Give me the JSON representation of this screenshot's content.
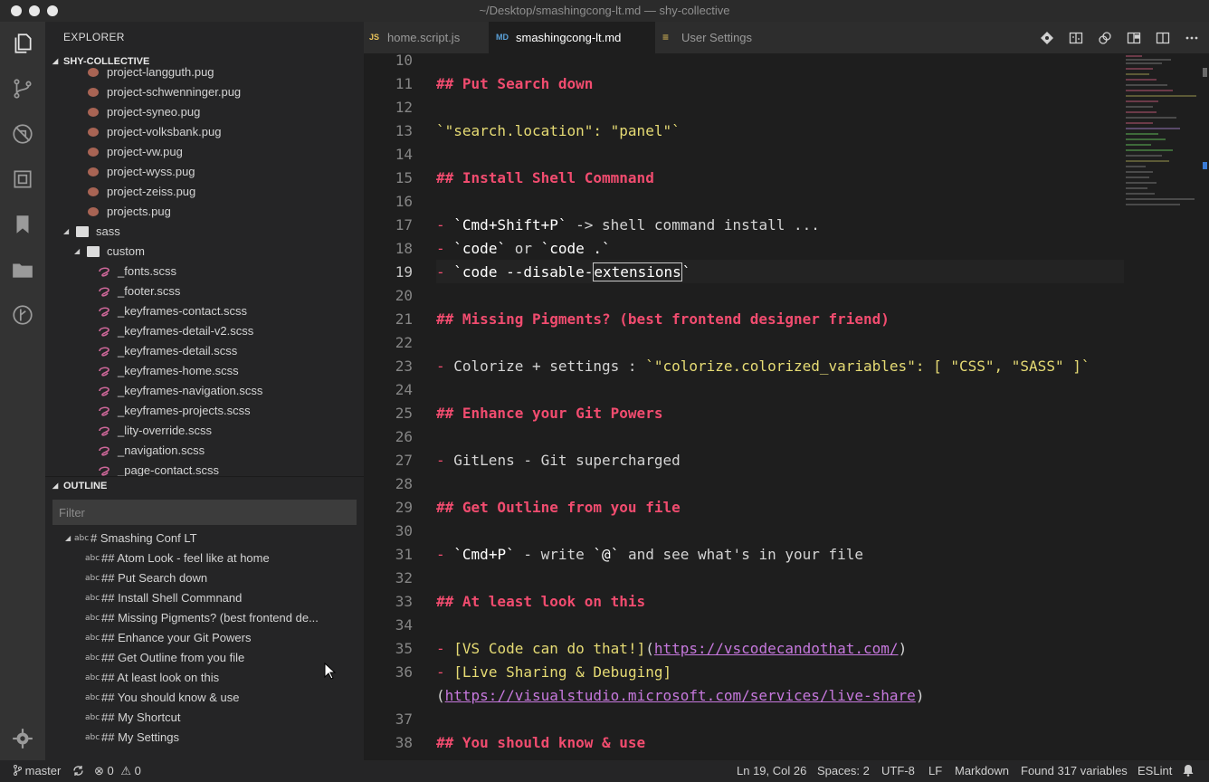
{
  "window": {
    "title": "~/Desktop/smashingcong-lt.md — shy-collective"
  },
  "sidebar": {
    "title": "EXPLORER",
    "project": "SHY-COLLECTIVE",
    "files": [
      "project-langguth.pug",
      "project-schwenninger.pug",
      "project-syneo.pug",
      "project-volksbank.pug",
      "project-vw.pug",
      "project-wyss.pug",
      "project-zeiss.pug",
      "projects.pug"
    ],
    "folders": {
      "sass": "sass",
      "custom": "custom"
    },
    "scss_files": [
      "_fonts.scss",
      "_footer.scss",
      "_keyframes-contact.scss",
      "_keyframes-detail-v2.scss",
      "_keyframes-detail.scss",
      "_keyframes-home.scss",
      "_keyframes-navigation.scss",
      "_keyframes-projects.scss",
      "_lity-override.scss",
      "_navigation.scss",
      "_page-contact.scss"
    ]
  },
  "outline": {
    "title": "OUTLINE",
    "filter_placeholder": "Filter",
    "symbol_kind": "abc",
    "root": "# Smashing Conf LT",
    "items": [
      "## Atom Look - feel like at home",
      "## Put Search down",
      "## Install Shell Commnand",
      "## Missing Pigments? (best frontend de...",
      "## Enhance your Git Powers",
      "## Get Outline from you file",
      "## At least look on this",
      "## You should know & use",
      "## My Shortcut",
      "## My Settings"
    ]
  },
  "tabs": [
    {
      "icon": "JS",
      "label": "home.script.js"
    },
    {
      "icon": "MD",
      "label": "smashingcong-lt.md"
    },
    {
      "icon": "≡",
      "label": "User Settings"
    }
  ],
  "editor": {
    "line_numbers": [
      "10",
      "11",
      "12",
      "13",
      "14",
      "15",
      "16",
      "17",
      "18",
      "19",
      "20",
      "21",
      "22",
      "23",
      "24",
      "25",
      "26",
      "27",
      "28",
      "29",
      "30",
      "31",
      "32",
      "33",
      "34",
      "35",
      "36",
      "37",
      "38"
    ],
    "current_line": "19",
    "lines": {
      "l11": "## Put Search down",
      "l13": "`\"search.location\": \"panel\"`",
      "l15": "## Install Shell Commnand",
      "l17_dash": "-",
      "l17_code": "`Cmd+Shift+P`",
      "l17_rest": " -> shell command install ...",
      "l18_dash": "-",
      "l18_code1": "`code`",
      "l18_mid": " or ",
      "l18_code2": "`code .`",
      "l19_dash": "-",
      "l19_a": "`code --disable-",
      "l19_sel": "extensions",
      "l19_b": "`",
      "l21": "## Missing Pigments? (best frontend designer friend)",
      "l23_dash": "-",
      "l23_text": " Colorize + settings : ",
      "l23_code": "`\"colorize.colorized_variables\": [ \"CSS\", \"SASS\" ]`",
      "l25": "## Enhance your Git Powers",
      "l27_dash": "-",
      "l27_text": " GitLens - Git supercharged",
      "l29": "## Get Outline from you file",
      "l31_dash": "-",
      "l31_code1": "`Cmd+P`",
      "l31_mid": " - write ",
      "l31_code2": "`@`",
      "l31_rest": " and see what's in your file",
      "l33": "## At least look on this",
      "l35_dash": "-",
      "l35_link": "[VS Code can do that!]",
      "l35_po": "(",
      "l35_url": "https://vscodecandothat.com/",
      "l35_pc": ")",
      "l36_dash": "-",
      "l36_link": "[Live Sharing & Debuging]",
      "l36_po": "(",
      "l36_url": "https://visualstudio.microsoft.com/services/live-share",
      "l36_pc": ")",
      "l38": "## You should know & use"
    }
  },
  "statusbar": {
    "branch": "master",
    "errors": "0",
    "warnings": "0",
    "position": "Ln 19, Col 26",
    "spaces": "Spaces: 2",
    "encoding": "UTF-8",
    "eol": "LF",
    "language": "Markdown",
    "variables": "Found 317 variables",
    "linter": "ESLint"
  },
  "colors": {
    "heading": "#f14c6f",
    "string": "#e6db74",
    "url": "#c678dd",
    "sass_icon": "#cd6799",
    "pug_icon": "#a86454"
  }
}
